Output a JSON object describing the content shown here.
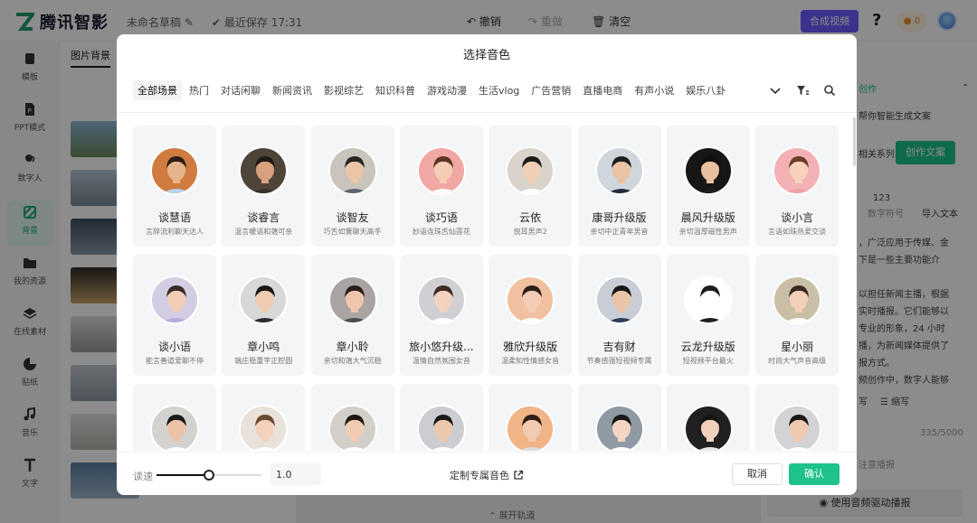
{
  "header": {
    "brand": "腾讯智影",
    "draft_name": "未命名草稿",
    "save_status": "最近保存 17:31",
    "undo": "撤销",
    "redo": "重做",
    "clear": "清空",
    "compose": "合成视频",
    "coins": "0"
  },
  "nav": [
    {
      "label": "模板",
      "icon": "template-icon"
    },
    {
      "label": "PPT模式",
      "icon": "ppt-icon"
    },
    {
      "label": "数字人",
      "icon": "digital-human-icon"
    },
    {
      "label": "背景",
      "icon": "background-icon"
    },
    {
      "label": "我的资源",
      "icon": "folder-icon"
    },
    {
      "label": "在线素材",
      "icon": "layers-icon"
    },
    {
      "label": "贴纸",
      "icon": "sticker-icon"
    },
    {
      "label": "音乐",
      "icon": "music-icon"
    },
    {
      "label": "文字",
      "icon": "text-icon"
    }
  ],
  "panel": {
    "tab": "图片背景"
  },
  "canvas": {
    "expand_track": "展开轨道"
  },
  "right_panel": {
    "title_fragment": "创作",
    "hint": "帮你智能生成文案",
    "related": "相关系列",
    "create_btn": "创作文案",
    "count_value": "123",
    "count_label": "数字符号",
    "import_label": "导入文本",
    "body": [
      "，广泛应用于传媒、金",
      "下是一些主要功能介",
      "",
      "以担任新闻主播，根据",
      "实时播报。它们能够以",
      "专业的形象，24 小时",
      "播，为新闻媒体提供了",
      "报方式。",
      "频创作中，数字人能够"
    ],
    "expand": "写",
    "shrink": "缩写",
    "char_count": "335/5000",
    "broadcast_hint": "注意播报",
    "drive_btn": "使用音频驱动播报"
  },
  "modal": {
    "title": "选择音色",
    "categories": [
      "全部场景",
      "热门",
      "对话闲聊",
      "新闻资讯",
      "影视综艺",
      "知识科普",
      "游戏动漫",
      "生活vlog",
      "广告营销",
      "直播电商",
      "有声小说",
      "娱乐八卦"
    ],
    "active_category": "全部场景",
    "voices": [
      {
        "name": "谈慧语",
        "desc": "言辞流利聊天达人",
        "skin": "#e6b38d",
        "hair": "#2a1d15",
        "bg": "#d07b3f",
        "cloth": "#b8d4ea"
      },
      {
        "name": "谈睿言",
        "desc": "温言暖语和蔼可亲",
        "skin": "#d8a07c",
        "hair": "#1f1a16",
        "bg": "#4f4438",
        "cloth": "#39332d"
      },
      {
        "name": "谈智友",
        "desc": "巧舌如簧聊天高手",
        "skin": "#ecc4a6",
        "hair": "#252525",
        "bg": "#c9c4bc",
        "cloth": "#5a6673"
      },
      {
        "name": "谈巧语",
        "desc": "妙语连珠舌灿莲花",
        "skin": "#f3cdb4",
        "hair": "#5b3423",
        "bg": "#f1a7a3",
        "cloth": "#ffffff"
      },
      {
        "name": "云依",
        "desc": "悦耳男声2",
        "skin": "#f0cdb5",
        "hair": "#1b1b1b",
        "bg": "#d9d3cc",
        "cloth": "#ffffff"
      },
      {
        "name": "康哥升级版",
        "desc": "亲切中正青年男音",
        "skin": "#ebc2a3",
        "hair": "#1c1c1c",
        "bg": "#cfd6dc",
        "cloth": "#232c3b"
      },
      {
        "name": "晨风升级版",
        "desc": "亲切温厚磁性男声",
        "skin": "#e8bfa0",
        "hair": "#0f0f0f",
        "bg": "#161616",
        "cloth": "#1d1d1d"
      },
      {
        "name": "谈小言",
        "desc": "言语如珠热爱交谈",
        "skin": "#f6d2bd",
        "hair": "#6d3c2b",
        "bg": "#f3b1b5",
        "cloth": "#f0a1a4"
      },
      {
        "name": "谈小语",
        "desc": "能言善道爱聊不停",
        "skin": "#f2cdb6",
        "hair": "#3a2c27",
        "bg": "#d3cde4",
        "cloth": "#b9a9e0"
      },
      {
        "name": "章小鸣",
        "desc": "端庄稳重字正腔圆",
        "skin": "#f0cbb2",
        "hair": "#1b1716",
        "bg": "#d8d8d8",
        "cloth": "#2c2c30"
      },
      {
        "name": "章小聆",
        "desc": "亲切和蔼大气沉稳",
        "skin": "#efc6ad",
        "hair": "#2a1e19",
        "bg": "#a9a4a3",
        "cloth": "#4c4c52"
      },
      {
        "name": "旅小悠升级...",
        "desc": "温情自然氛围女音",
        "skin": "#f3d2c0",
        "hair": "#3c2c24",
        "bg": "#d0cfd4",
        "cloth": "#ffffff"
      },
      {
        "name": "雅欣升级版",
        "desc": "温柔知性情感女音",
        "skin": "#f2ccb4",
        "hair": "#2c1d17",
        "bg": "#f1c0a0",
        "cloth": "#ffffff"
      },
      {
        "name": "吉有财",
        "desc": "节奏感强短视频专属",
        "skin": "#eac4a6",
        "hair": "#181818",
        "bg": "#c9ced6",
        "cloth": "#2f3c58"
      },
      {
        "name": "云龙升级版",
        "desc": "短视频平台最火",
        "skin": "#ffffff",
        "hair": "#1d1d1d",
        "bg": "#ffffff",
        "cloth": "#1f1f1f"
      },
      {
        "name": "星小丽",
        "desc": "时尚大气声音高级",
        "skin": "#f2cfb9",
        "hair": "#3a2a22",
        "bg": "#c9bfa6",
        "cloth": "#ffffff"
      },
      {
        "name": "",
        "desc": "",
        "skin": "#ebc4a8",
        "hair": "#1a1a1a",
        "bg": "#d4d2cf",
        "cloth": "#ffffff"
      },
      {
        "name": "",
        "desc": "",
        "skin": "#f3d1bb",
        "hair": "#6b4a33",
        "bg": "#e8e2da",
        "cloth": "#ffffff"
      },
      {
        "name": "",
        "desc": "",
        "skin": "#f0ccb5",
        "hair": "#21170f",
        "bg": "#d2cfc9",
        "cloth": "#ffffff"
      },
      {
        "name": "",
        "desc": "",
        "skin": "#eec8ad",
        "hair": "#1b1b1b",
        "bg": "#cccdd1",
        "cloth": "#ffffff"
      },
      {
        "name": "",
        "desc": "",
        "skin": "#f1cbb1",
        "hair": "#2d1e15",
        "bg": "#f1b487",
        "cloth": "#dcdcdc"
      },
      {
        "name": "",
        "desc": "",
        "skin": "#f4d4c2",
        "hair": "#181818",
        "bg": "#8f9aa5",
        "cloth": "#ffffff"
      },
      {
        "name": "",
        "desc": "",
        "skin": "#f2d0bb",
        "hair": "#151515",
        "bg": "#202020",
        "cloth": "#e8e8e8"
      },
      {
        "name": "",
        "desc": "",
        "skin": "#efcab0",
        "hair": "#1a1a1a",
        "bg": "#d3d3d6",
        "cloth": "#ffffff"
      }
    ],
    "speed_label": "读速",
    "speed_value": "1.0",
    "speed_fraction": 0.5,
    "custom_voice": "定制专属音色",
    "cancel": "取消",
    "confirm": "确认"
  },
  "colors": {
    "accent": "#1ec28b",
    "compose": "#6a5cff"
  }
}
